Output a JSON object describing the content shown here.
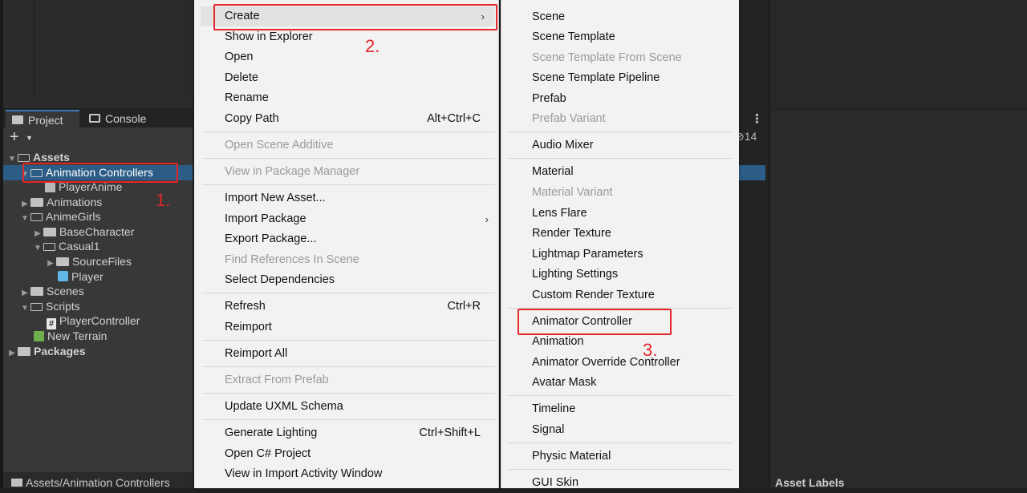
{
  "project_panel": {
    "tabs": [
      {
        "label": "Project",
        "icon": "folder-icon"
      },
      {
        "label": "Console",
        "icon": "console-icon"
      }
    ],
    "toolbar": {
      "add_icon": "plus-icon",
      "count": "14"
    },
    "tree": [
      {
        "label": "Assets",
        "bold": true
      },
      {
        "label": "Animation Controllers",
        "selected": true
      },
      {
        "label": "PlayerAnime"
      },
      {
        "label": "Animations"
      },
      {
        "label": "AnimeGirls"
      },
      {
        "label": "BaseCharacter"
      },
      {
        "label": "Casual1"
      },
      {
        "label": "SourceFiles"
      },
      {
        "label": "Player"
      },
      {
        "label": "Scenes"
      },
      {
        "label": "Scripts"
      },
      {
        "label": "PlayerController"
      },
      {
        "label": "New Terrain"
      },
      {
        "label": "Packages",
        "bold": true
      }
    ],
    "status_path": "Assets/Animation Controllers"
  },
  "inspector": {
    "asset_labels": "Asset Labels"
  },
  "context_menu": {
    "items": [
      {
        "label": "Create",
        "submenu": true,
        "highlighted": true
      },
      {
        "label": "Show in Explorer"
      },
      {
        "label": "Open"
      },
      {
        "label": "Delete"
      },
      {
        "label": "Rename"
      },
      {
        "label": "Copy Path",
        "shortcut": "Alt+Ctrl+C"
      },
      {
        "label": "Open Scene Additive",
        "disabled": true
      },
      {
        "label": "View in Package Manager",
        "disabled": true
      },
      {
        "label": "Import New Asset..."
      },
      {
        "label": "Import Package",
        "submenu": true
      },
      {
        "label": "Export Package..."
      },
      {
        "label": "Find References In Scene",
        "disabled": true
      },
      {
        "label": "Select Dependencies"
      },
      {
        "label": "Refresh",
        "shortcut": "Ctrl+R"
      },
      {
        "label": "Reimport"
      },
      {
        "label": "Reimport All"
      },
      {
        "label": "Extract From Prefab",
        "disabled": true
      },
      {
        "label": "Update UXML Schema"
      },
      {
        "label": "Generate Lighting",
        "shortcut": "Ctrl+Shift+L"
      },
      {
        "label": "Open C# Project"
      },
      {
        "label": "View in Import Activity Window"
      }
    ]
  },
  "create_submenu": {
    "items": [
      {
        "label": "Scene"
      },
      {
        "label": "Scene Template"
      },
      {
        "label": "Scene Template From Scene",
        "disabled": true
      },
      {
        "label": "Scene Template Pipeline"
      },
      {
        "label": "Prefab"
      },
      {
        "label": "Prefab Variant",
        "disabled": true
      },
      {
        "label": "Audio Mixer"
      },
      {
        "label": "Material"
      },
      {
        "label": "Material Variant",
        "disabled": true
      },
      {
        "label": "Lens Flare"
      },
      {
        "label": "Render Texture"
      },
      {
        "label": "Lightmap Parameters"
      },
      {
        "label": "Lighting Settings"
      },
      {
        "label": "Custom Render Texture"
      },
      {
        "label": "Animator Controller"
      },
      {
        "label": "Animation"
      },
      {
        "label": "Animator Override Controller"
      },
      {
        "label": "Avatar Mask"
      },
      {
        "label": "Timeline"
      },
      {
        "label": "Signal"
      },
      {
        "label": "Physic Material"
      },
      {
        "label": "GUI Skin"
      }
    ]
  },
  "annotations": {
    "step1": "1.",
    "step2": "2.",
    "step3": "3.",
    "color": "#e5262a"
  }
}
